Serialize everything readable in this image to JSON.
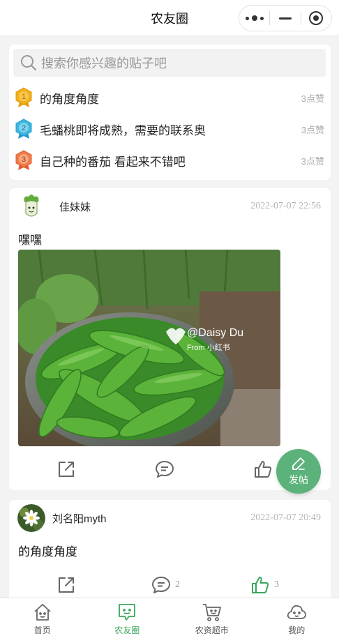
{
  "header": {
    "title": "农友圈"
  },
  "search": {
    "placeholder": "搜索你感兴趣的贴子吧"
  },
  "hot_posts": [
    {
      "rank": "1",
      "title": "的角度角度",
      "likes": "3点赞",
      "color": "#f2b01e"
    },
    {
      "rank": "2",
      "title": "毛蟠桃即将成熟，需要的联系奥",
      "likes": "3点赞",
      "color": "#3ab7e0"
    },
    {
      "rank": "3",
      "title": "自己种的番茄 看起来不错吧",
      "likes": "3点赞",
      "color": "#f07a4a"
    }
  ],
  "posts": [
    {
      "author": "佳妹妹",
      "date": "2022-07-07 22:56",
      "text": "嘿嘿",
      "image_watermark": "@Daisy Du",
      "image_watermark_sub": "From 小红书",
      "comments": "",
      "likes": ""
    },
    {
      "author": "刘名阳myth",
      "date": "2022-07-07 20:49",
      "text": "的角度角度",
      "comments": "2",
      "likes": "3"
    }
  ],
  "fab": {
    "label": "发帖"
  },
  "tabs": [
    {
      "label": "首页",
      "icon": "home-icon"
    },
    {
      "label": "农友圈",
      "icon": "chat-icon"
    },
    {
      "label": "农资超市",
      "icon": "cart-icon"
    },
    {
      "label": "我的",
      "icon": "user-cloud-icon"
    }
  ],
  "colors": {
    "accent": "#3aa55a",
    "fab": "#5bb27a"
  }
}
